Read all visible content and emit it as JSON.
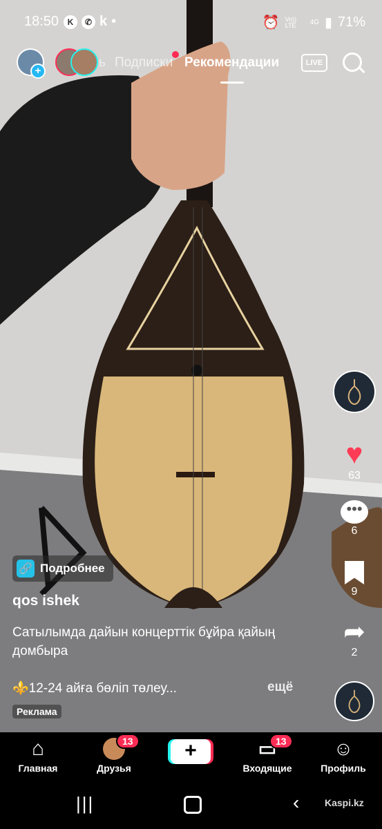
{
  "status_bar": {
    "time": "18:50",
    "app_icons": [
      "kaspi-icon",
      "whatsapp-icon",
      "k-icon"
    ],
    "dot": "•",
    "signal_text_1": "Vo)) LTE",
    "signal_text_2": "4G",
    "battery": "71%"
  },
  "top_nav": {
    "tab_partial": "ь",
    "tab_following": "Подписки",
    "tab_recommended": "Рекомендации",
    "live": "LIVE"
  },
  "side_actions": {
    "likes": "63",
    "comments": "6",
    "saves": "9",
    "shares": "2"
  },
  "ad": {
    "more_label": "Подробнее",
    "username": "qos ishek",
    "caption": "Сатылымда дайын концерттік бұйра қайың домбыра",
    "promo": "⚜️12-24 айға бөліп төлеу...",
    "expand": "ещё",
    "ad_label": "Реклама"
  },
  "bottom_nav": {
    "home": "Главная",
    "friends": "Друзья",
    "friends_badge": "13",
    "inbox": "Входящие",
    "inbox_badge": "13",
    "profile": "Профиль"
  },
  "system_nav": {
    "watermark": "Kaspi.kz"
  },
  "colors": {
    "accent_red": "#fe2c55",
    "accent_cyan": "#25f4ee",
    "heart": "#ff3b55"
  }
}
